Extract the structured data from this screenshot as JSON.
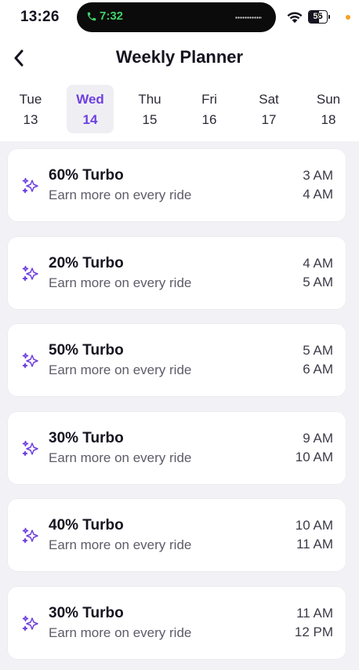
{
  "status_bar": {
    "time": "13:26",
    "call_time": "7:32",
    "battery": "55",
    "battery_level": 0.55
  },
  "header": {
    "title": "Weekly Planner"
  },
  "days": [
    {
      "name": "Tue",
      "date": "13",
      "selected": false
    },
    {
      "name": "Wed",
      "date": "14",
      "selected": true
    },
    {
      "name": "Thu",
      "date": "15",
      "selected": false
    },
    {
      "name": "Fri",
      "date": "16",
      "selected": false
    },
    {
      "name": "Sat",
      "date": "17",
      "selected": false
    },
    {
      "name": "Sun",
      "date": "18",
      "selected": false
    }
  ],
  "cards": [
    {
      "title": "60% Turbo",
      "subtitle": "Earn more on every ride",
      "start": "3 AM",
      "end": "4 AM"
    },
    {
      "title": "20% Turbo",
      "subtitle": "Earn more on every ride",
      "start": "4 AM",
      "end": "5 AM"
    },
    {
      "title": "50% Turbo",
      "subtitle": "Earn more on every ride",
      "start": "5 AM",
      "end": "6 AM"
    },
    {
      "title": "30% Turbo",
      "subtitle": "Earn more on every ride",
      "start": "9 AM",
      "end": "10 AM"
    },
    {
      "title": "40% Turbo",
      "subtitle": "Earn more on every ride",
      "start": "10 AM",
      "end": "11 AM"
    },
    {
      "title": "30% Turbo",
      "subtitle": "Earn more on every ride",
      "start": "11 AM",
      "end": "12 PM"
    }
  ],
  "colors": {
    "accent": "#6d3fe0",
    "call_green": "#3fd266",
    "list_background": "#f2f2f6",
    "privacy_dot": "#f7a021"
  },
  "icons": {
    "back": "chevron-left-icon",
    "turbo": "sparkle-icon",
    "wifi": "wifi-icon",
    "call": "phone-icon"
  }
}
